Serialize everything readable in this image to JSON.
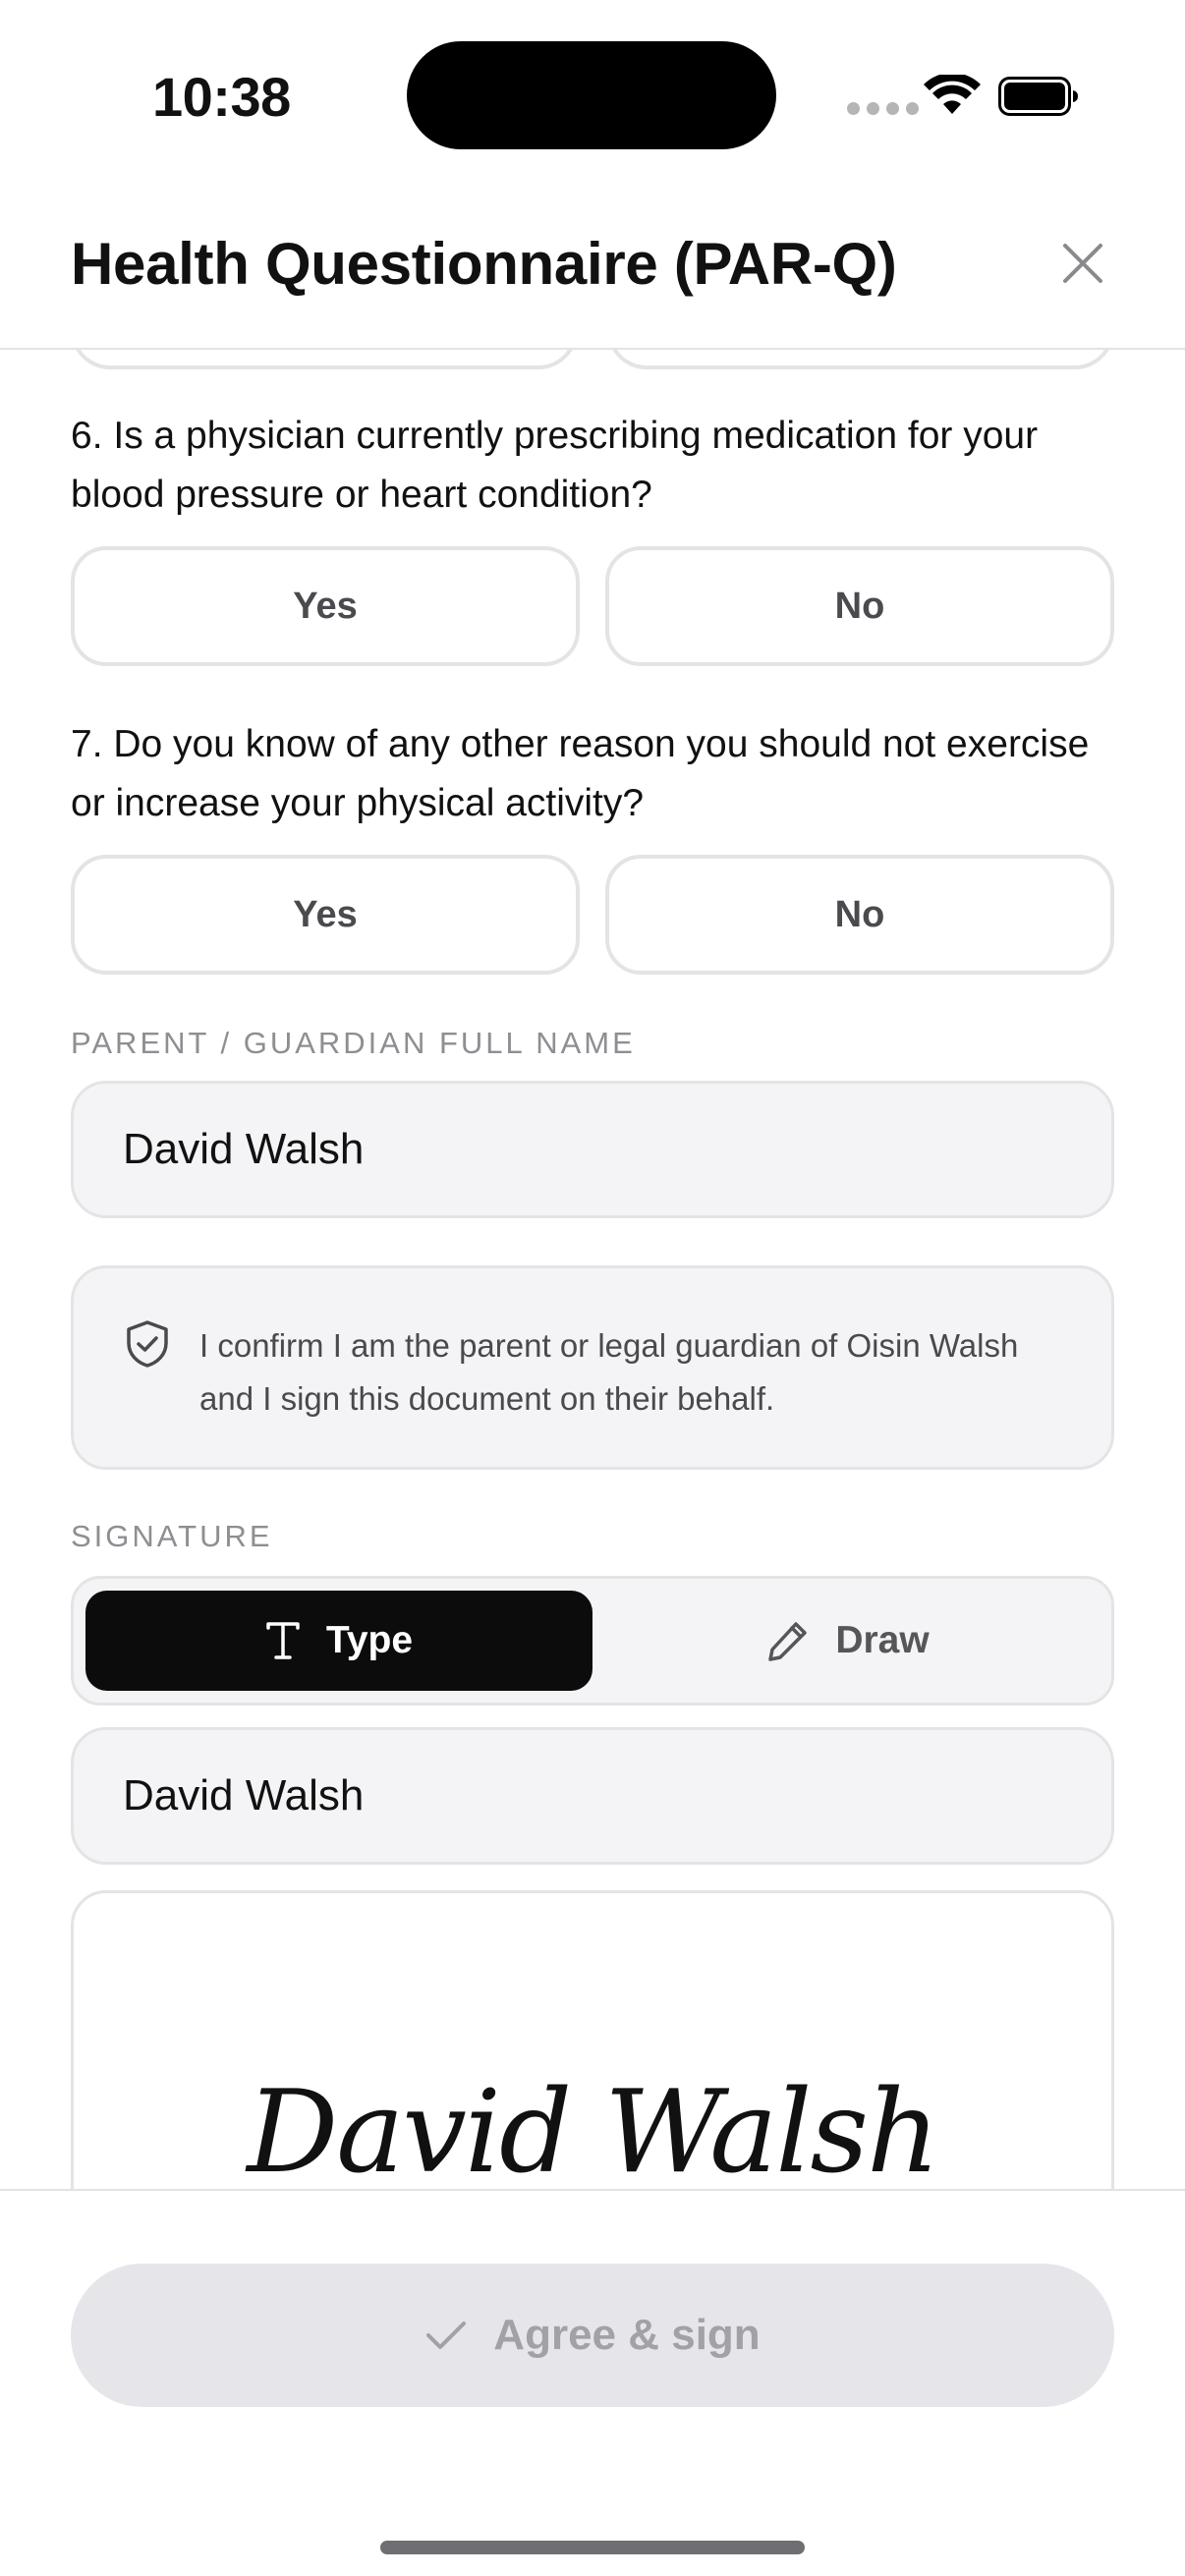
{
  "status_bar": {
    "time": "10:38"
  },
  "header": {
    "title": "Health Questionnaire (PAR-Q)"
  },
  "questions": [
    {
      "text": "6. Is a physician currently prescribing medication for your blood pressure or heart condition?",
      "yes_label": "Yes",
      "no_label": "No"
    },
    {
      "text": "7. Do you know of any other reason you should not exercise or increase your physical activity?",
      "yes_label": "Yes",
      "no_label": "No"
    }
  ],
  "guardian": {
    "label": "PARENT / GUARDIAN FULL NAME",
    "value": "David Walsh",
    "confirmation": "I confirm I am the parent or legal guardian of Oisin Walsh and I sign this document on their behalf."
  },
  "signature": {
    "label": "SIGNATURE",
    "mode_type_label": "Type",
    "mode_draw_label": "Draw",
    "selected_mode": "Type",
    "typed_value": "David Walsh",
    "preview_text": "David Walsh"
  },
  "footer": {
    "agree_label": "Agree & sign",
    "agree_enabled": false
  },
  "icons": {
    "close": "close-icon",
    "shield": "shield-check-icon",
    "type": "text-cursor-icon",
    "draw": "pencil-icon",
    "check": "check-icon"
  },
  "colors": {
    "primary": "#0c0c0c",
    "disabled_button": "#e5e5ea",
    "disabled_text": "#a1a1a6",
    "field_background": "#f4f4f6",
    "border": "#e4e4e7"
  }
}
